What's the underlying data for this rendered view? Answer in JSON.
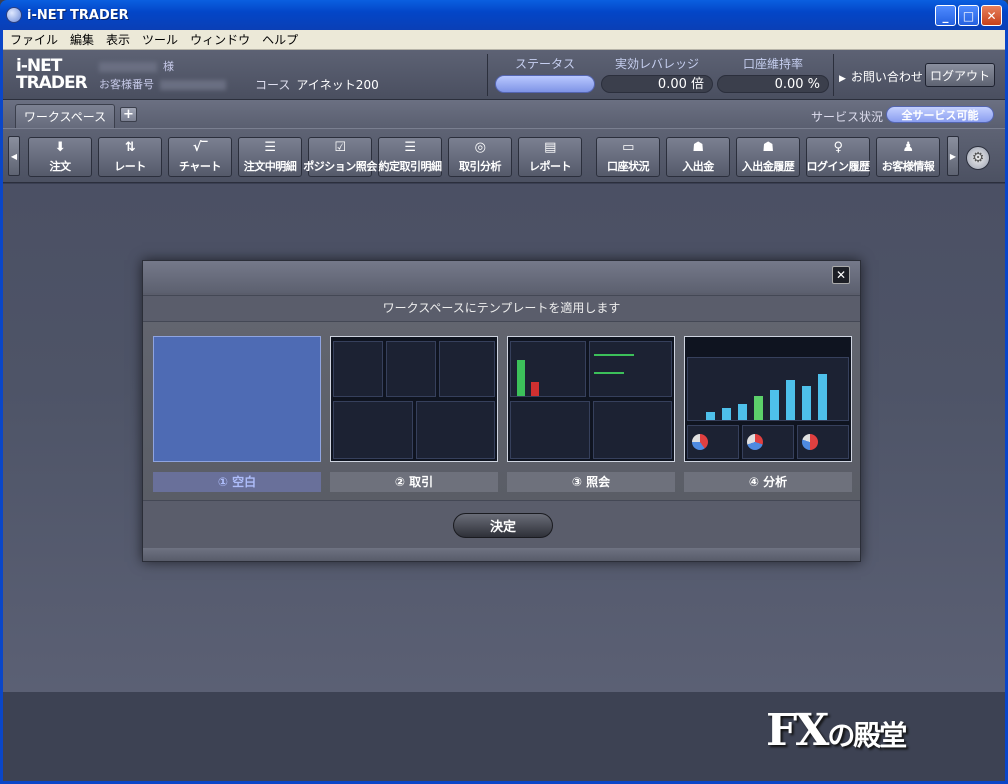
{
  "window": {
    "title": "i-NET TRADER",
    "minimize": "_",
    "maximize": "□",
    "close": "✕"
  },
  "menu": [
    "ファイル",
    "編集",
    "表示",
    "ツール",
    "ウィンドウ",
    "ヘルプ"
  ],
  "header": {
    "logo_line1": "i-NET",
    "logo_line2": "TRADER",
    "customer_suffix": "様",
    "customer_number_label": "お客様番号",
    "course_label": "コース",
    "course_value": "アイネット200",
    "status_label": "ステータス",
    "leverage_label": "実効レバレッジ",
    "leverage_value": "0.00 倍",
    "margin_label": "口座維持率",
    "margin_value": "0.00 %",
    "inquiry": "お問い合わせ",
    "logout": "ログアウト"
  },
  "tabs": {
    "workspace": "ワークスペース",
    "add": "+",
    "service_label": "サービス状況",
    "service_value": "全サービス可能"
  },
  "toolbar": [
    {
      "label": "注文",
      "icon": "⬇"
    },
    {
      "label": "レート",
      "icon": "⇅"
    },
    {
      "label": "チャート",
      "icon": "√‾"
    },
    {
      "label": "注文中明細",
      "icon": "☰"
    },
    {
      "label": "ポジション照会",
      "icon": "☑"
    },
    {
      "label": "約定取引明細",
      "icon": "☰"
    },
    {
      "label": "取引分析",
      "icon": "◎"
    },
    {
      "label": "レポート",
      "icon": "▤"
    },
    {
      "label": "口座状況",
      "icon": "▭"
    },
    {
      "label": "入出金",
      "icon": "☗"
    },
    {
      "label": "入出金履歴",
      "icon": "☗"
    },
    {
      "label": "ログイン履歴",
      "icon": "♀"
    },
    {
      "label": "お客様情報",
      "icon": "♟"
    }
  ],
  "dialog": {
    "title": "ワークスペースにテンプレートを適用します",
    "close": "✕",
    "templates": [
      "① 空白",
      "② 取引",
      "③ 照会",
      "④ 分析"
    ],
    "confirm": "決定"
  },
  "watermark": {
    "main": "FX",
    "sub": "の殿堂"
  },
  "colors": {
    "accent": "#4e6bb4",
    "titlebar": "#0346c8"
  }
}
